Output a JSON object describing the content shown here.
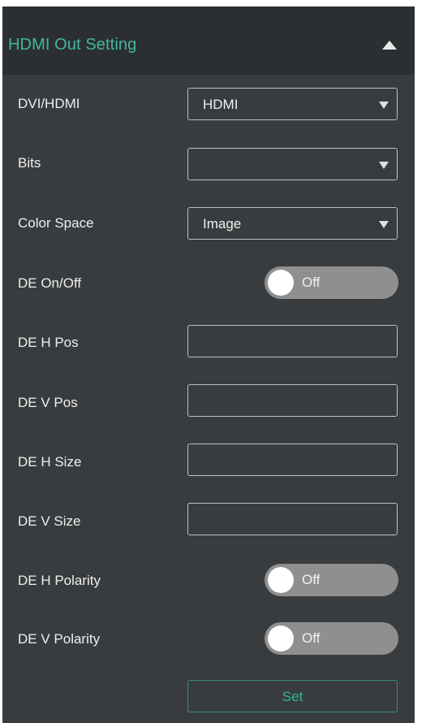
{
  "header": {
    "title": "HDMI Out Setting",
    "toggle_icon": "chevron-up-icon"
  },
  "fields": {
    "dvi_hdmi": {
      "label": "DVI/HDMI",
      "value": "HDMI"
    },
    "bits": {
      "label": "Bits",
      "value": ""
    },
    "color_space": {
      "label": "Color Space",
      "value": "Image"
    },
    "de_onoff": {
      "label": "DE On/Off",
      "state": "Off"
    },
    "de_h_pos": {
      "label": "DE H Pos",
      "value": ""
    },
    "de_v_pos": {
      "label": "DE V Pos",
      "value": ""
    },
    "de_h_size": {
      "label": "DE H Size",
      "value": ""
    },
    "de_v_size": {
      "label": "DE V Size",
      "value": ""
    },
    "de_h_polarity": {
      "label": "DE H Polarity",
      "state": "Off"
    },
    "de_v_polarity": {
      "label": "DE V Polarity",
      "state": "Off"
    }
  },
  "actions": {
    "set_label": "Set"
  },
  "colors": {
    "accent": "#3fb8a0",
    "panel": "#393c3e",
    "header": "#2c2f31",
    "toggle_off": "#8f8f8f"
  }
}
